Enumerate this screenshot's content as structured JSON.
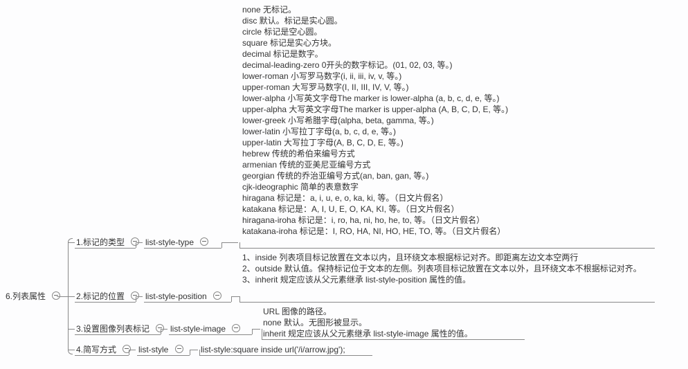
{
  "root": {
    "label": "6.列表属性"
  },
  "branches": {
    "b1": {
      "label": "1.标记的类型",
      "prop": "list-style-type"
    },
    "b2": {
      "label": "2.标记的位置",
      "prop": "list-style-position"
    },
    "b3": {
      "label": "3.设置图像列表标记",
      "prop": "list-style-image"
    },
    "b4": {
      "label": "4.简写方式",
      "prop": "list-style",
      "example": "list-style:square inside url('/i/arrow.jpg');"
    }
  },
  "typeValues": [
    "none    无标记。",
    "disc     默认。标记是实心圆。",
    "circle    标记是空心圆。",
    "square  标记是实心方块。",
    "decimal          标记是数字。",
    "decimal-leading-zero    0开头的数字标记。(01, 02, 03, 等。)",
    "lower-roman    小写罗马数字(i, ii, iii, iv, v, 等。)",
    "upper-roman    大写罗马数字(I, II, III, IV, V, 等。)",
    "lower-alpha      小写英文字母The marker is lower-alpha (a, b, c, d, e, 等。)",
    "upper-alpha      大写英文字母The marker is upper-alpha (A, B, C, D, E, 等。)",
    "lower-greek      小写希腊字母(alpha, beta, gamma, 等。)",
    "lower-latin       小写拉丁字母(a, b, c, d, e, 等。)",
    "upper-latin       大写拉丁字母(A, B, C, D, E, 等。)",
    "hebrew   传统的希伯来编号方式",
    "armenian        传统的亚美尼亚编号方式",
    "georgian         传统的乔治亚编号方式(an, ban, gan, 等。)",
    "cjk-ideographic 简单的表意数字",
    "hiragana         标记是：a, i, u, e, o, ka, ki, 等。（日文片假名）",
    "katakana         标记是：A, I, U, E, O, KA, KI, 等。（日文片假名）",
    "hiragana-iroha  标记是：i, ro, ha, ni, ho, he, to, 等。（日文片假名）",
    "katakana-iroha  标记是：I, RO, HA, NI, HO, HE, TO, 等。（日文片假名）"
  ],
  "positionValues": [
    "1、inside        列表项目标记放置在文本以内，且环绕文本根据标记对齐。即距离左边文本空两行",
    "2、outside       默认值。保持标记位于文本的左侧。列表项目标记放置在文本以外，且环绕文本不根据标记对齐。",
    "3、inherit        规定应该从父元素继承 list-style-position 属性的值。"
  ],
  "imageValues": [
    "URL      图像的路径。",
    "none    默认。无图形被显示。",
    "inherit  规定应该从父元素继承 list-style-image 属性的值。"
  ]
}
